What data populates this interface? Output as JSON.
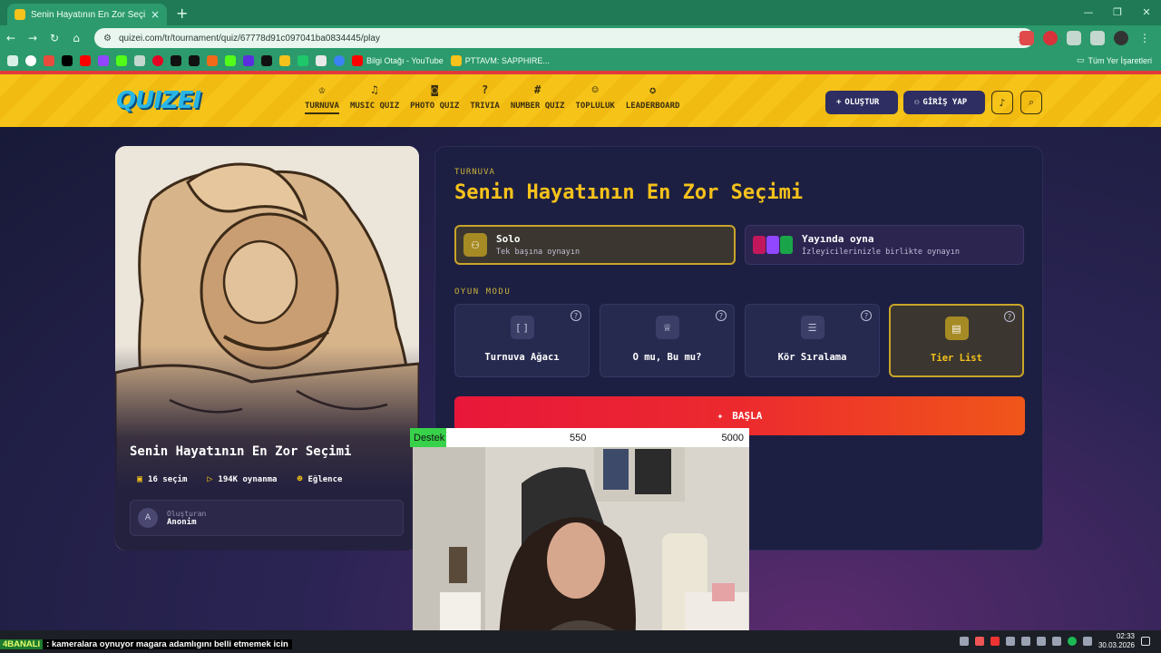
{
  "browser": {
    "tab_title": "Senin Hayatının En Zor Seçimi",
    "url": "quizei.com/tr/tournament/quiz/67778d91c097041ba0834445/play",
    "bookmarks": [
      "Bilgi Otağı - YouTube",
      "PTTAVM: SAPPHIRE..."
    ],
    "bookmarks_right": "Tüm Yer İşaretleri"
  },
  "site": {
    "logo": "QUIZEI",
    "nav": [
      {
        "label": "TURNUVA",
        "icon": "trophy-icon"
      },
      {
        "label": "MUSIC QUIZ",
        "icon": "music-icon"
      },
      {
        "label": "PHOTO QUIZ",
        "icon": "camera-icon"
      },
      {
        "label": "TRIVIA",
        "icon": "question-icon"
      },
      {
        "label": "NUMBER QUIZ",
        "icon": "hash-icon"
      },
      {
        "label": "TOPLULUK",
        "icon": "users-icon"
      },
      {
        "label": "LEADERBOARD",
        "icon": "award-icon"
      }
    ],
    "create_label": "OLUŞTUR",
    "login_label": "GİRİŞ YAP"
  },
  "quiz": {
    "title": "Senin Hayatının En Zor Seçimi",
    "choices": "16 seçim",
    "plays": "194K oynanma",
    "category": "Eğlence",
    "creator_label": "Oluşturan",
    "creator_name": "Anonim",
    "creator_initial": "A"
  },
  "panel": {
    "kicker": "TURNUVA",
    "title": "Senin Hayatının En Zor Seçimi",
    "solo_title": "Solo",
    "solo_sub": "Tek başına oynayın",
    "live_title": "Yayında oyna",
    "live_sub": "İzleyicilerinizle birlikte oynayın",
    "mode_label": "OYUN MODU",
    "modes": [
      "Turnuva Ağacı",
      "O mu, Bu mu?",
      "Kör Sıralama",
      "Tier List"
    ],
    "selected_mode": "Tier List",
    "start_label": "BAŞLA"
  },
  "overlay": {
    "donation_label": "Destek",
    "donation_current": "550",
    "donation_goal": "5000",
    "ticker_tag": "4BANALI",
    "ticker_msg": ": kameralara oynuyor magara adamlıgını belli etmemek icin"
  },
  "taskbar": {
    "time": "02:33",
    "date": "30.03.2026"
  },
  "colors": {
    "accent": "#f6c21b",
    "header_bg": "#f6c419",
    "start_btn": "#e8173a",
    "browser_green": "#2c9a6c"
  }
}
